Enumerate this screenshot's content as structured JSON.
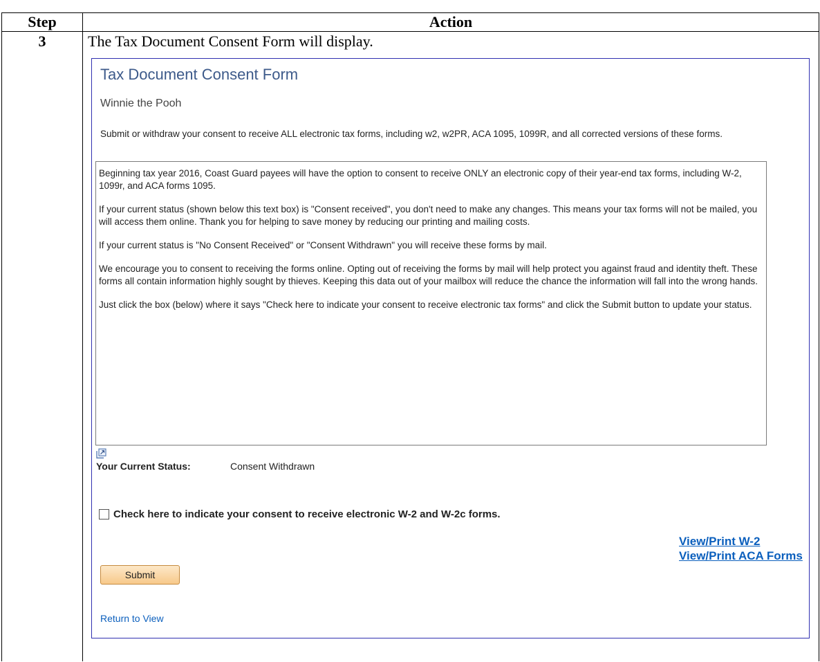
{
  "table": {
    "header_step": "Step",
    "header_action": "Action",
    "step_number": "3",
    "action_text": "The Tax Document Consent Form will display."
  },
  "form": {
    "title": "Tax Document Consent Form",
    "name": "Winnie the Pooh",
    "instructions": "Submit or withdraw your consent to receive ALL electronic tax forms, including w2, w2PR, ACA 1095, 1099R, and all corrected versions of these forms.",
    "textbox_paragraphs": [
      "Beginning tax year 2016, Coast Guard payees will have the option to consent to receive ONLY an electronic copy of their year-end tax forms, including W-2, 1099r, and ACA forms 1095.",
      "If your current status (shown below this text box) is \"Consent received\", you don't need to make any changes. This means your tax forms will not be mailed, you will access them online. Thank you for helping to save money by reducing our printing and mailing costs.",
      "If your current status is \"No Consent Received\" or  \"Consent Withdrawn\" you will receive these forms by mail.",
      "We encourage you to consent to receiving the forms online. Opting out of receiving the forms by mail will help protect you against fraud and identity theft. These forms all contain information highly sought by thieves. Keeping this data out of your mailbox will reduce the chance the information will fall into the wrong hands.",
      "Just click the box (below) where it says \"Check here to indicate your consent to receive electronic tax forms\" and click the Submit button to update your status."
    ],
    "status_label": "Your Current Status:",
    "status_value": "Consent Withdrawn",
    "consent_checkbox_label": "Check here to indicate your consent to receive electronic W-2 and W-2c forms.",
    "consent_checked": false,
    "link_view_w2": "View/Print W-2",
    "link_view_aca": "View/Print ACA Forms",
    "submit_label": "Submit",
    "return_link": "Return to View"
  },
  "colors": {
    "title": "#3d5a8a",
    "link": "#0b5fbd",
    "frame_border": "#2f2fb0",
    "button_fill": "#f7c98a"
  }
}
